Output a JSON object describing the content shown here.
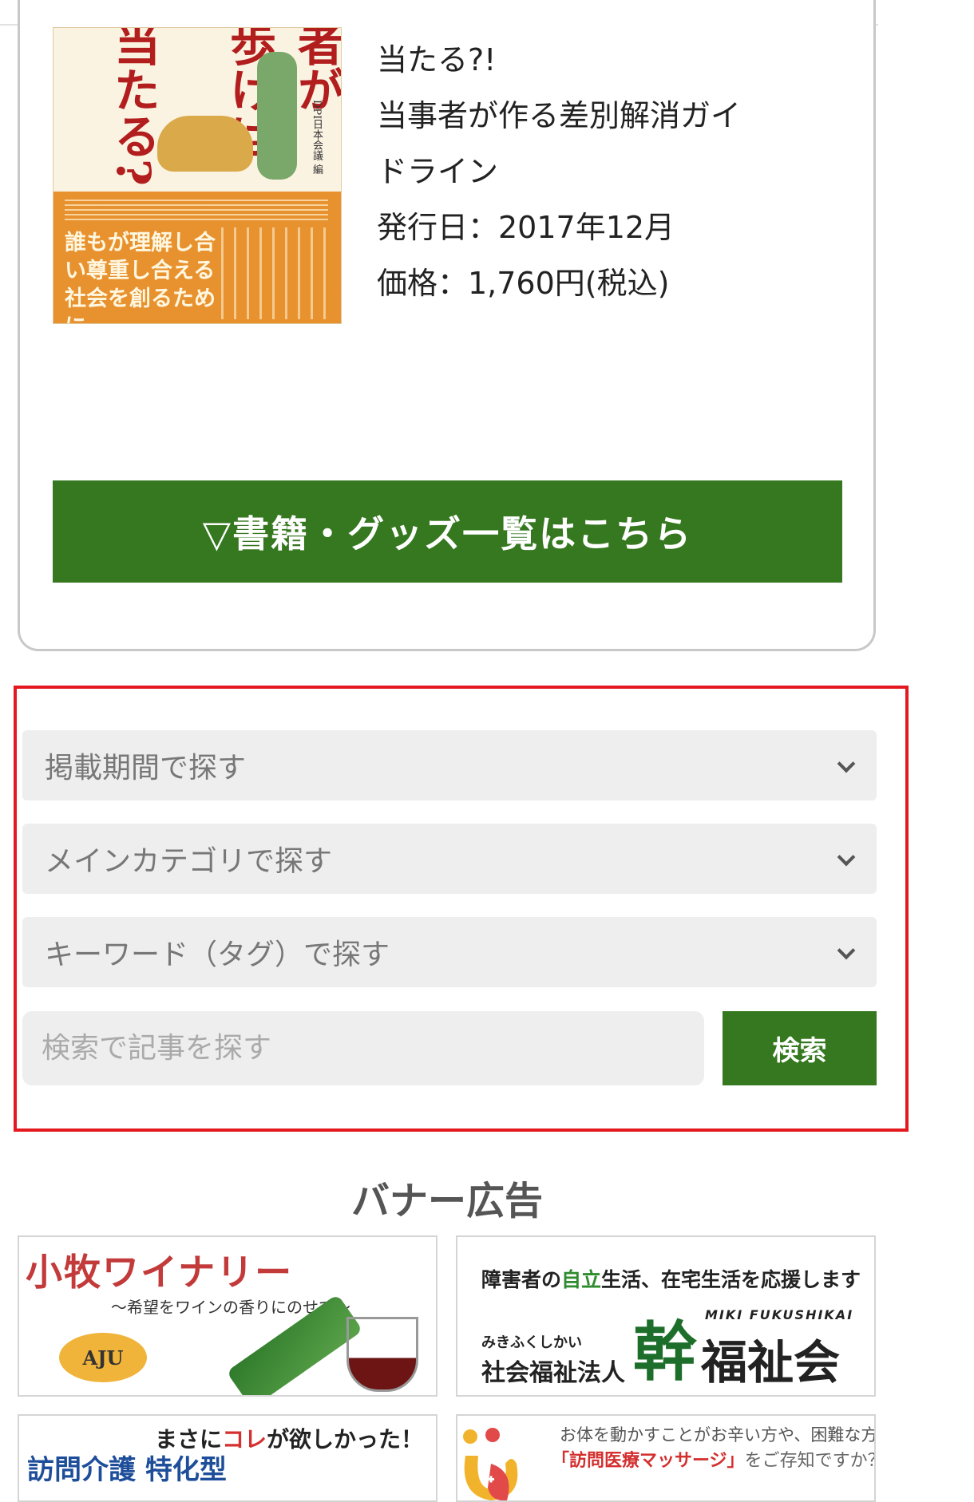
{
  "book": {
    "cover": {
      "title_col1": "者が",
      "title_col2": "歩けば",
      "title_col3": "当たる?!",
      "org": "DPI日本会議 編",
      "subtitle": "誰もが理解し合い尊重し合える社会を創るために"
    },
    "info": {
      "line1": "当たる?!",
      "line2": "当事者が作る差別解消ガイ",
      "line3": "ドライン",
      "publish_date": "発行日：2017年12月",
      "price": "価格：1,760円(税込)"
    },
    "list_button": "▽書籍・グッズ一覧はこちら"
  },
  "search": {
    "period_select": "掲載期間で探す",
    "category_select": "メインカテゴリで探す",
    "keyword_select": "キーワード（タグ）で探す",
    "input_placeholder": "検索で記事を探す",
    "submit_label": "検索"
  },
  "banners": {
    "heading": "バナー広告",
    "komaki": {
      "title": "小牧ワイナリー",
      "subtitle": "〜希望をワインの香りにのせて〜",
      "logo": "AJU"
    },
    "miki": {
      "tagline_pre": "障害者の",
      "tagline_green": "自立",
      "tagline_post": "生活、在宅生活を応援します",
      "reading": "みきふくしかい",
      "corp": "社会福祉法人",
      "kanji": "幹",
      "english": "MIKI FUKUSHIKAI",
      "name": "福祉会"
    },
    "kaigo": {
      "line1_pre": "まさに",
      "line1_red": "コレ",
      "line1_post": "が欲しかった！",
      "line2": "訪問介護 特化型"
    },
    "massage": {
      "line1": "お体を動かすことがお辛い方や、困難な方",
      "line2_red": "「訪問医療マッサージ」",
      "line2_post": "をご存知ですか？"
    }
  }
}
